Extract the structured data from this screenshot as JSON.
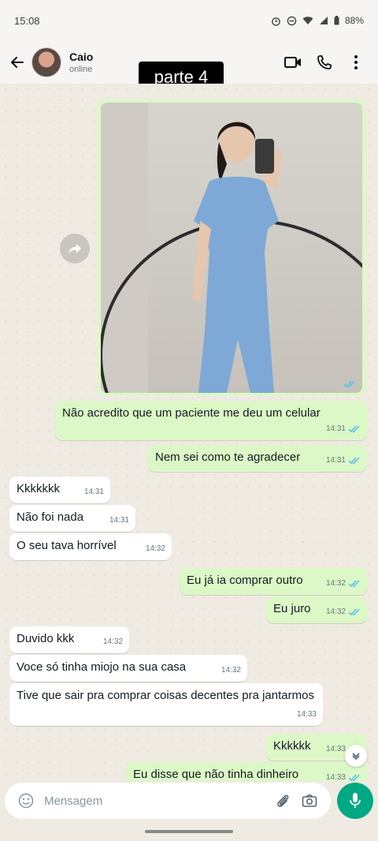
{
  "status_bar": {
    "time": "15:08",
    "battery": "88%"
  },
  "header": {
    "name": "Caio",
    "status": "online"
  },
  "overlay": {
    "title": "parte 4"
  },
  "messages": [
    {
      "dir": "out",
      "text": "Não acredito que um paciente me deu um celular",
      "time": "14:31"
    },
    {
      "dir": "out",
      "text": "Nem sei como te agradecer",
      "time": "14:31"
    },
    {
      "dir": "in",
      "text": "Kkkkkkk",
      "time": "14:31"
    },
    {
      "dir": "in",
      "text": "Não foi nada",
      "time": "14:31"
    },
    {
      "dir": "in",
      "text": "O seu tava horrível",
      "time": "14:32"
    },
    {
      "dir": "out",
      "text": "Eu já ia comprar outro",
      "time": "14:32"
    },
    {
      "dir": "out",
      "text": "Eu juro",
      "time": "14:32"
    },
    {
      "dir": "in",
      "text": "Duvido kkk",
      "time": "14:32"
    },
    {
      "dir": "in",
      "text": "Voce só tinha miojo na sua casa",
      "time": "14:32"
    },
    {
      "dir": "in",
      "text": "Tive que sair pra comprar coisas decentes pra jantarmos",
      "time": "14:33"
    },
    {
      "dir": "out",
      "text": "Kkkkkk",
      "time": "14:33"
    },
    {
      "dir": "out",
      "text": "Eu disse que não tinha dinheiro",
      "time": "14:33"
    }
  ],
  "composer": {
    "placeholder": "Mensagem"
  },
  "colors": {
    "outgoing": "#dcf8c6",
    "incoming": "#ffffff",
    "accent": "#00a884",
    "read_ticks": "#53bdeb"
  }
}
